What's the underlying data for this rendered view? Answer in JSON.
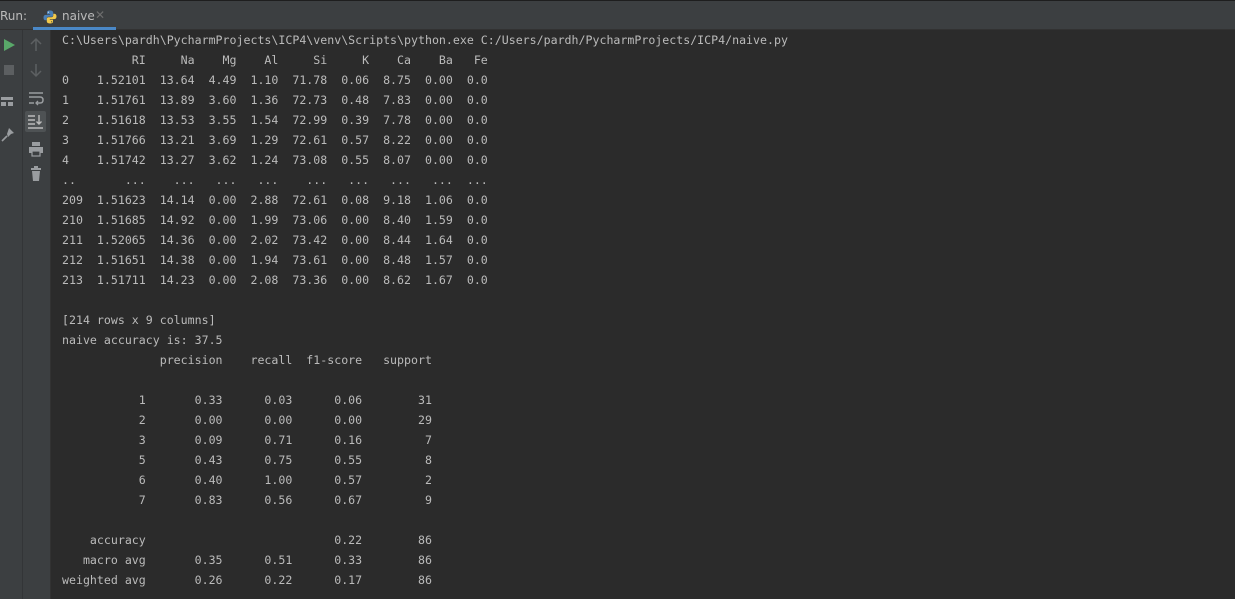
{
  "tabbar": {
    "run_label": "Run:",
    "tab_label": "naive",
    "tab_close": "✕"
  },
  "toolbar": {
    "icons": [
      "play-icon",
      "stop-icon",
      "layout-icon",
      "pin-icon",
      "up-arrow-icon",
      "down-arrow-icon",
      "soft-wrap-icon",
      "scroll-to-end-icon",
      "print-icon",
      "trash-icon"
    ]
  },
  "colors": {
    "background": "#2b2b2b",
    "panel": "#3c3f41",
    "text": "#bbbbbb",
    "run_green": "#59a869",
    "accent": "#4a88c7"
  },
  "console": {
    "lines": [
      "C:\\Users\\pardh\\PycharmProjects\\ICP4\\venv\\Scripts\\python.exe C:/Users/pardh/PycharmProjects/ICP4/naive.py",
      "          RI     Na    Mg    Al     Si     K    Ca    Ba   Fe",
      "0    1.52101  13.64  4.49  1.10  71.78  0.06  8.75  0.00  0.0",
      "1    1.51761  13.89  3.60  1.36  72.73  0.48  7.83  0.00  0.0",
      "2    1.51618  13.53  3.55  1.54  72.99  0.39  7.78  0.00  0.0",
      "3    1.51766  13.21  3.69  1.29  72.61  0.57  8.22  0.00  0.0",
      "4    1.51742  13.27  3.62  1.24  73.08  0.55  8.07  0.00  0.0",
      "..       ...    ...   ...   ...    ...   ...   ...   ...  ...",
      "209  1.51623  14.14  0.00  2.88  72.61  0.08  9.18  1.06  0.0",
      "210  1.51685  14.92  0.00  1.99  73.06  0.00  8.40  1.59  0.0",
      "211  1.52065  14.36  0.00  2.02  73.42  0.00  8.44  1.64  0.0",
      "212  1.51651  14.38  0.00  1.94  73.61  0.00  8.48  1.57  0.0",
      "213  1.51711  14.23  0.00  2.08  73.36  0.00  8.62  1.67  0.0",
      "",
      "[214 rows x 9 columns]",
      "naive accuracy is: 37.5",
      "              precision    recall  f1-score   support",
      "",
      "           1       0.33      0.03      0.06        31",
      "           2       0.00      0.00      0.00        29",
      "           3       0.09      0.71      0.16         7",
      "           5       0.43      0.75      0.55         8",
      "           6       0.40      1.00      0.57         2",
      "           7       0.83      0.56      0.67         9",
      "",
      "    accuracy                           0.22        86",
      "   macro avg       0.35      0.51      0.33        86",
      "weighted avg       0.26      0.22      0.17        86"
    ]
  }
}
